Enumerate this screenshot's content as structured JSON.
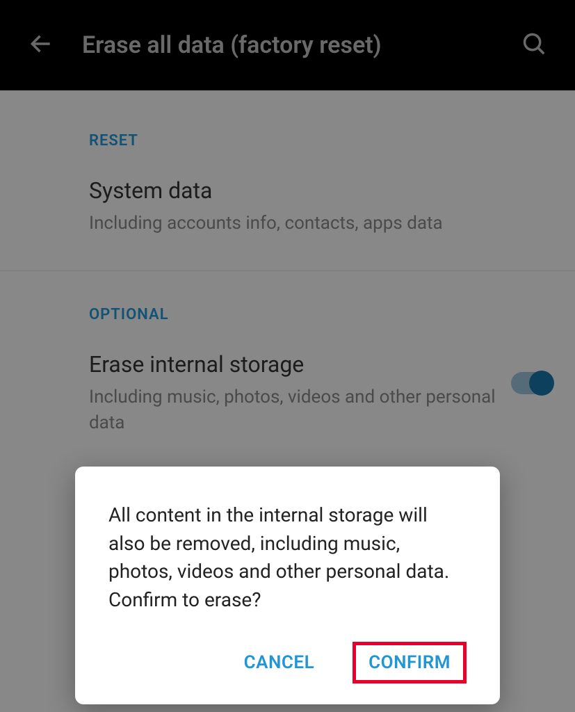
{
  "header": {
    "title": "Erase all data (factory reset)"
  },
  "sections": {
    "reset": {
      "label": "RESET",
      "item_title": "System data",
      "item_subtitle": "Including accounts info, contacts, apps data"
    },
    "optional": {
      "label": "OPTIONAL",
      "item_title": "Erase internal storage",
      "item_subtitle": "Including music, photos, videos and other personal data",
      "toggle_on": true
    }
  },
  "dialog": {
    "message": "All content in the internal storage will also be removed, including music, photos, videos and other personal data. Confirm to erase?",
    "cancel": "CANCEL",
    "confirm": "CONFIRM"
  }
}
